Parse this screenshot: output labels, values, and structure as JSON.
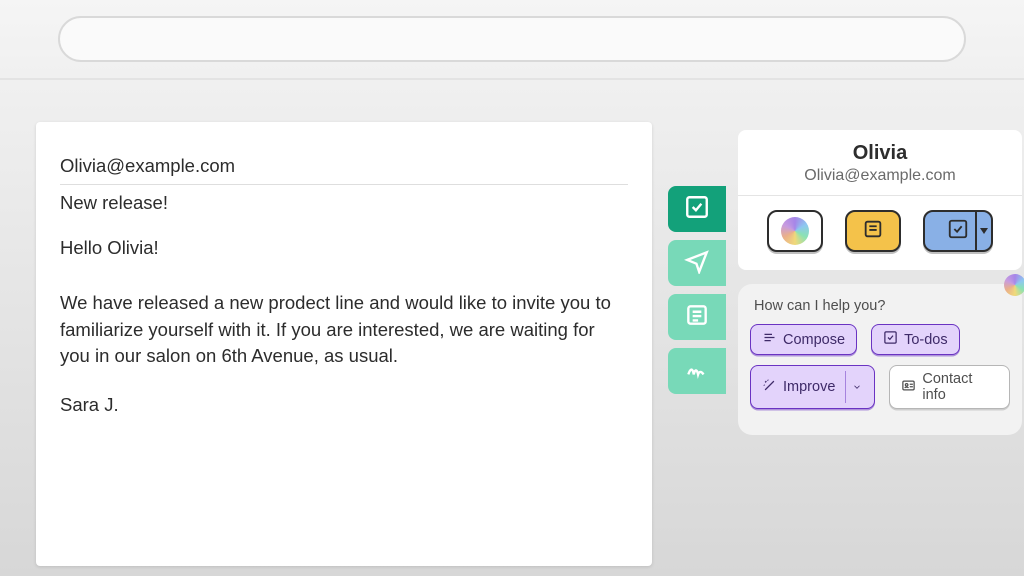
{
  "topbar": {
    "search_placeholder": ""
  },
  "email": {
    "to": "Olivia@example.com",
    "subject": "New release!",
    "greeting": "Hello Olivia!",
    "body": "We have released a new prodect line and would like to invite you to familiarize yourself with it. If you are interested, we are waiting for you in our salon on 6th Avenue, as usual.",
    "signature": "Sara J."
  },
  "side_tabs": [
    {
      "icon": "check-square-icon",
      "variant": "dark"
    },
    {
      "icon": "send-icon",
      "variant": "light"
    },
    {
      "icon": "note-icon",
      "variant": "light"
    },
    {
      "icon": "signature-icon",
      "variant": "light"
    }
  ],
  "contact": {
    "name": "Olivia",
    "email": "Olivia@example.com"
  },
  "tiles": [
    {
      "name": "ai-tile",
      "icon": "orb-icon",
      "color": "white"
    },
    {
      "name": "note-tile",
      "icon": "note-icon",
      "color": "yellow"
    },
    {
      "name": "task-tile",
      "icon": "check-square-icon",
      "color": "blue",
      "has_dropdown": true
    }
  ],
  "assistant": {
    "prompt": "How can I help you?",
    "actions": {
      "compose": "Compose",
      "todos": "To-dos",
      "improve": "Improve",
      "contact_info": "Contact info"
    }
  }
}
